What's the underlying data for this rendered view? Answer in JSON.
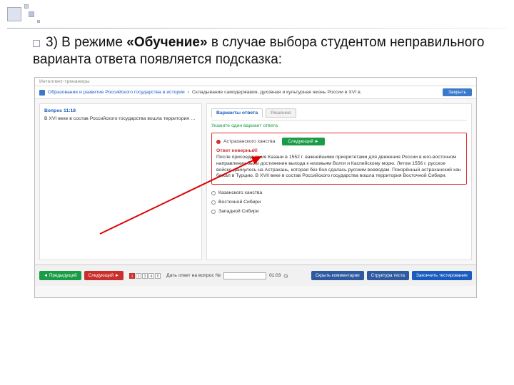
{
  "slide": {
    "bullet_title_pre": "3) В режиме ",
    "bullet_title_bold": "«Обучение»",
    "bullet_title_post": " в случае выбора студентом неправильного варианта ответа появляется подсказка:"
  },
  "app": {
    "header": "Интеллект-тренажеры",
    "breadcrumb_back": "Образование и развитие Российского государства в истории",
    "breadcrumb_cur": "Складывание самодержавия, духовная и культурная жизнь России в XVI в.",
    "close_label": "Закрыть"
  },
  "question": {
    "label": "Вопрос 11:18",
    "text": "В XVI веке в состав Российского государства вошла территория …"
  },
  "answers": {
    "tab_variants": "Варианты ответа",
    "tab_decision": "Решение",
    "instruction": "Укажите один вариант ответа",
    "wrong_option": "Астраханского ханства",
    "next_label": "Следующий ►",
    "hint_label": "Ответ неверный!",
    "hint_text": "После присоединения Казани в 1552 г. важнейшими приоритетами для движения России в юго-восточном направлении были достижение выхода к низовьям Волги и Каспийскому морю. Летом 1556 г. русское войско двинулось на Астрахань, которая без боя сдалась русским воеводам. Покорённый астраханский хан бежал в Турцию. В XVII веке в состав Российского государства вошла территория Восточной Сибири.",
    "opt_b": "Казанского ханства",
    "opt_c": "Восточной Сибири",
    "opt_d": "Западной Сибири"
  },
  "footer": {
    "prev": "◄ Предыдущий",
    "next": "Следующий ►",
    "jump_label": "Дать ответ на вопрос №",
    "jump_value": "",
    "timer": "01:03",
    "show_hints": "Скрыть комментарии",
    "test_structure": "Структура теста",
    "finish": "Закончить тестирование",
    "pages": [
      "1",
      "2",
      "3",
      "4",
      "5"
    ]
  }
}
